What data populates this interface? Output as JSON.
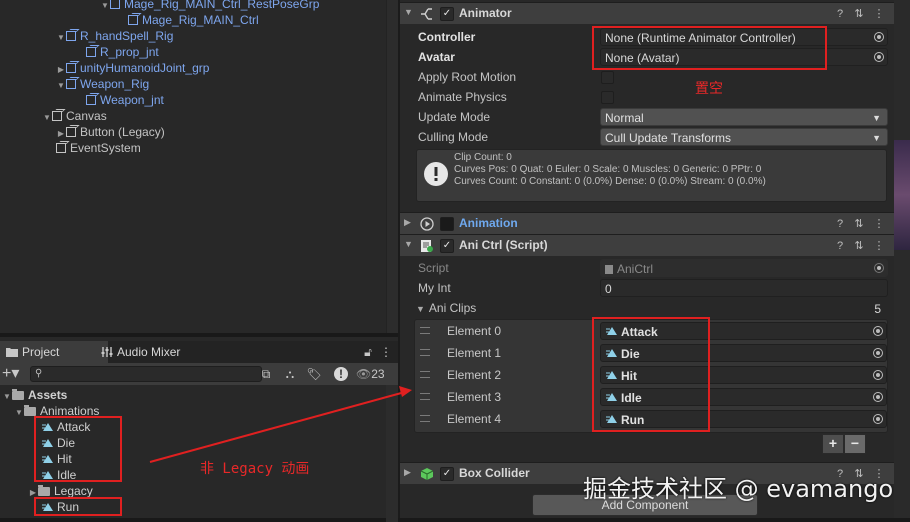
{
  "hierarchy": {
    "items": [
      {
        "label": "Mage_Rig_MAIN_Ctrl_RestPoseGrp",
        "blue": true
      },
      {
        "label": "Mage_Rig_MAIN_Ctrl",
        "blue": true
      },
      {
        "label": "R_handSpell_Rig",
        "blue": true
      },
      {
        "label": "R_prop_jnt",
        "blue": true
      },
      {
        "label": "unityHumanoidJoint_grp",
        "blue": true
      },
      {
        "label": "Weapon_Rig",
        "blue": true
      },
      {
        "label": "Weapon_jnt",
        "blue": true
      },
      {
        "label": "Canvas",
        "blue": false
      },
      {
        "label": "Button (Legacy)",
        "blue": false
      },
      {
        "label": "EventSystem",
        "blue": false
      }
    ]
  },
  "project": {
    "tabs": [
      {
        "label": "Project"
      },
      {
        "label": "Audio Mixer"
      }
    ],
    "hidden_count": "23",
    "tree": {
      "assets": "Assets",
      "animations": "Animations",
      "clips": [
        "Attack",
        "Die",
        "Hit",
        "Idle"
      ],
      "legacy": "Legacy",
      "run": "Run"
    }
  },
  "inspector": {
    "animator": {
      "title": "Animator",
      "controller_label": "Controller",
      "controller_value": "None (Runtime Animator Controller)",
      "avatar_label": "Avatar",
      "avatar_value": "None (Avatar)",
      "apply_root_motion": "Apply Root Motion",
      "animate_physics": "Animate Physics",
      "update_mode_label": "Update Mode",
      "update_mode_value": "Normal",
      "culling_mode_label": "Culling Mode",
      "culling_mode_value": "Cull Update Transforms",
      "info_lines": [
        "Clip Count: 0",
        "Curves Pos: 0 Quat: 0 Euler: 0 Scale: 0 Muscles: 0 Generic: 0 PPtr: 0",
        "Curves Count: 0 Constant: 0 (0.0%) Dense: 0 (0.0%) Stream: 0 (0.0%)"
      ]
    },
    "animation": {
      "title": "Animation"
    },
    "anictrl": {
      "title": "Ani Ctrl (Script)",
      "script_label": "Script",
      "script_value": "AniCtrl",
      "myint_label": "My Int",
      "myint_value": "0",
      "aniclips_label": "Ani Clips",
      "aniclips_count": "5",
      "elements": [
        {
          "label": "Element 0",
          "value": "Attack"
        },
        {
          "label": "Element 1",
          "value": "Die"
        },
        {
          "label": "Element 2",
          "value": "Hit"
        },
        {
          "label": "Element 3",
          "value": "Idle"
        },
        {
          "label": "Element 4",
          "value": "Run"
        }
      ],
      "plus": "+",
      "minus": "−"
    },
    "boxcollider": {
      "title": "Box Collider"
    },
    "add_component": "Add Component"
  },
  "annotations": {
    "empty_note": "置空",
    "non_legacy_note": "非 Legacy 动画",
    "watermark": "掘金技术社区 @ evamango",
    "color": "#e02020"
  }
}
